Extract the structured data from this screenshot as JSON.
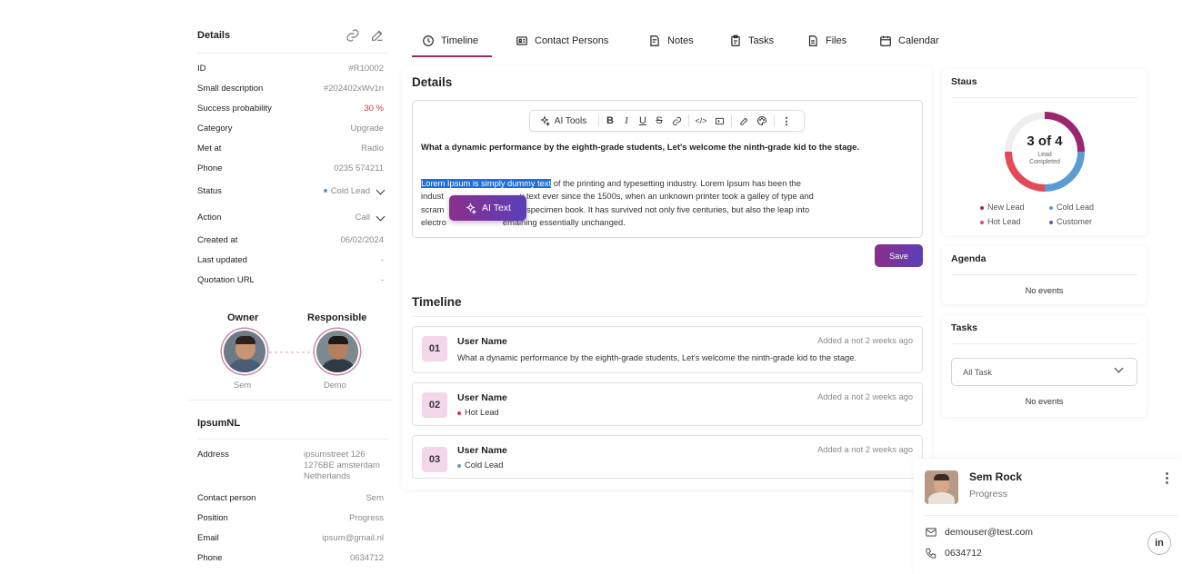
{
  "left": {
    "details_title": "Details",
    "fields": [
      {
        "label": "ID",
        "value": "#R10002"
      },
      {
        "label": "Small description",
        "value": "#202402xWv1n"
      },
      {
        "label": "Success probability",
        "value": "30 %"
      },
      {
        "label": "Category",
        "value": "Upgrade"
      },
      {
        "label": "Met at",
        "value": "Radio"
      },
      {
        "label": "Phone",
        "value": "0235 574211"
      },
      {
        "label": "Status",
        "value": "Cold Lead"
      },
      {
        "label": "Action",
        "value": "Call"
      },
      {
        "label": "Created at",
        "value": "06/02/2024"
      },
      {
        "label": "Last updated",
        "value": "-"
      },
      {
        "label": "Quotation URL",
        "value": "-"
      }
    ],
    "owner_label": "Owner",
    "responsible_label": "Responsible",
    "owner_name": "Sem",
    "responsible_name": "Demo",
    "company_title": "IpsumNL",
    "company_fields": [
      {
        "label": "Address",
        "value": "ipsumstreet 126\n1276BE amsterdam\nNetherlands"
      },
      {
        "label": "Contact person",
        "value": "Sem"
      },
      {
        "label": "Position",
        "value": "Progress"
      },
      {
        "label": "Email",
        "value": "ipsum@gmail.nl"
      },
      {
        "label": "Phone",
        "value": "0634712"
      }
    ]
  },
  "tabs": [
    {
      "label": "Timeline",
      "icon": "clock-icon",
      "active": true
    },
    {
      "label": "Contact Persons",
      "icon": "contact-card-icon"
    },
    {
      "label": "Notes",
      "icon": "notes-icon"
    },
    {
      "label": "Tasks",
      "icon": "clipboard-icon"
    },
    {
      "label": "Files",
      "icon": "file-icon"
    },
    {
      "label": "Calendar",
      "icon": "calendar-icon"
    }
  ],
  "editor": {
    "title": "Details",
    "ai_tools_label": "AI Tools",
    "bold_text": "What a dynamic performance by the eighth-grade students, Let's welcome the ninth-grade kid to the stage.",
    "selected_text": "Lorem Ipsum is simply dummy text",
    "line1_rest": " of the printing and  typesetting industry. Lorem Ipsum has been the",
    "line2_a": "indust",
    "line2_b": "y  text ever since the 1500s, when an unknown printer took a galley of  type and",
    "line3_a": "scram",
    "line3_b": "e specimen book. It has survived not  only five centuries, but also the leap into",
    "line4_a": "electro",
    "line4_b": "emaining essentially unchanged.",
    "ai_text_label": "AI Text",
    "save_label": "Save"
  },
  "timeline": {
    "title": "Timeline",
    "items": [
      {
        "num": "01",
        "user": "User Name",
        "date": "Added a not 2 weeks ago",
        "text": "What a dynamic performance by the eighth-grade students, Let's welcome the ninth-grade kid to the stage.",
        "status_color": ""
      },
      {
        "num": "02",
        "user": "User Name",
        "date": "Added a not 2 weeks ago",
        "text": "Hot Lead",
        "status_color": "#e0323b"
      },
      {
        "num": "03",
        "user": "User Name",
        "date": "Added a not 2 weeks ago",
        "text": "Cold Lead",
        "status_color": "#5b9bd5"
      }
    ]
  },
  "status_panel": {
    "title": "Staus",
    "center_value": "3 of 4",
    "center_sub1": "Lead",
    "center_sub2": "Completed",
    "legend": [
      {
        "label": "New Lead",
        "color": "#9a2770"
      },
      {
        "label": "Cold Lead",
        "color": "#5b9bd5"
      },
      {
        "label": "Hot Lead",
        "color": "#e24a57"
      },
      {
        "label": "Customer",
        "color": "#6a4fb0"
      }
    ]
  },
  "agenda_panel": {
    "title": "Agenda",
    "empty": "No events"
  },
  "tasks_panel": {
    "title": "Tasks",
    "select_value": "All Task",
    "empty": "No events"
  },
  "contact_card": {
    "name": "Sem Rock",
    "role": "Progress",
    "email": "demouser@test.com",
    "phone": "0634712",
    "linkedin": "in"
  }
}
